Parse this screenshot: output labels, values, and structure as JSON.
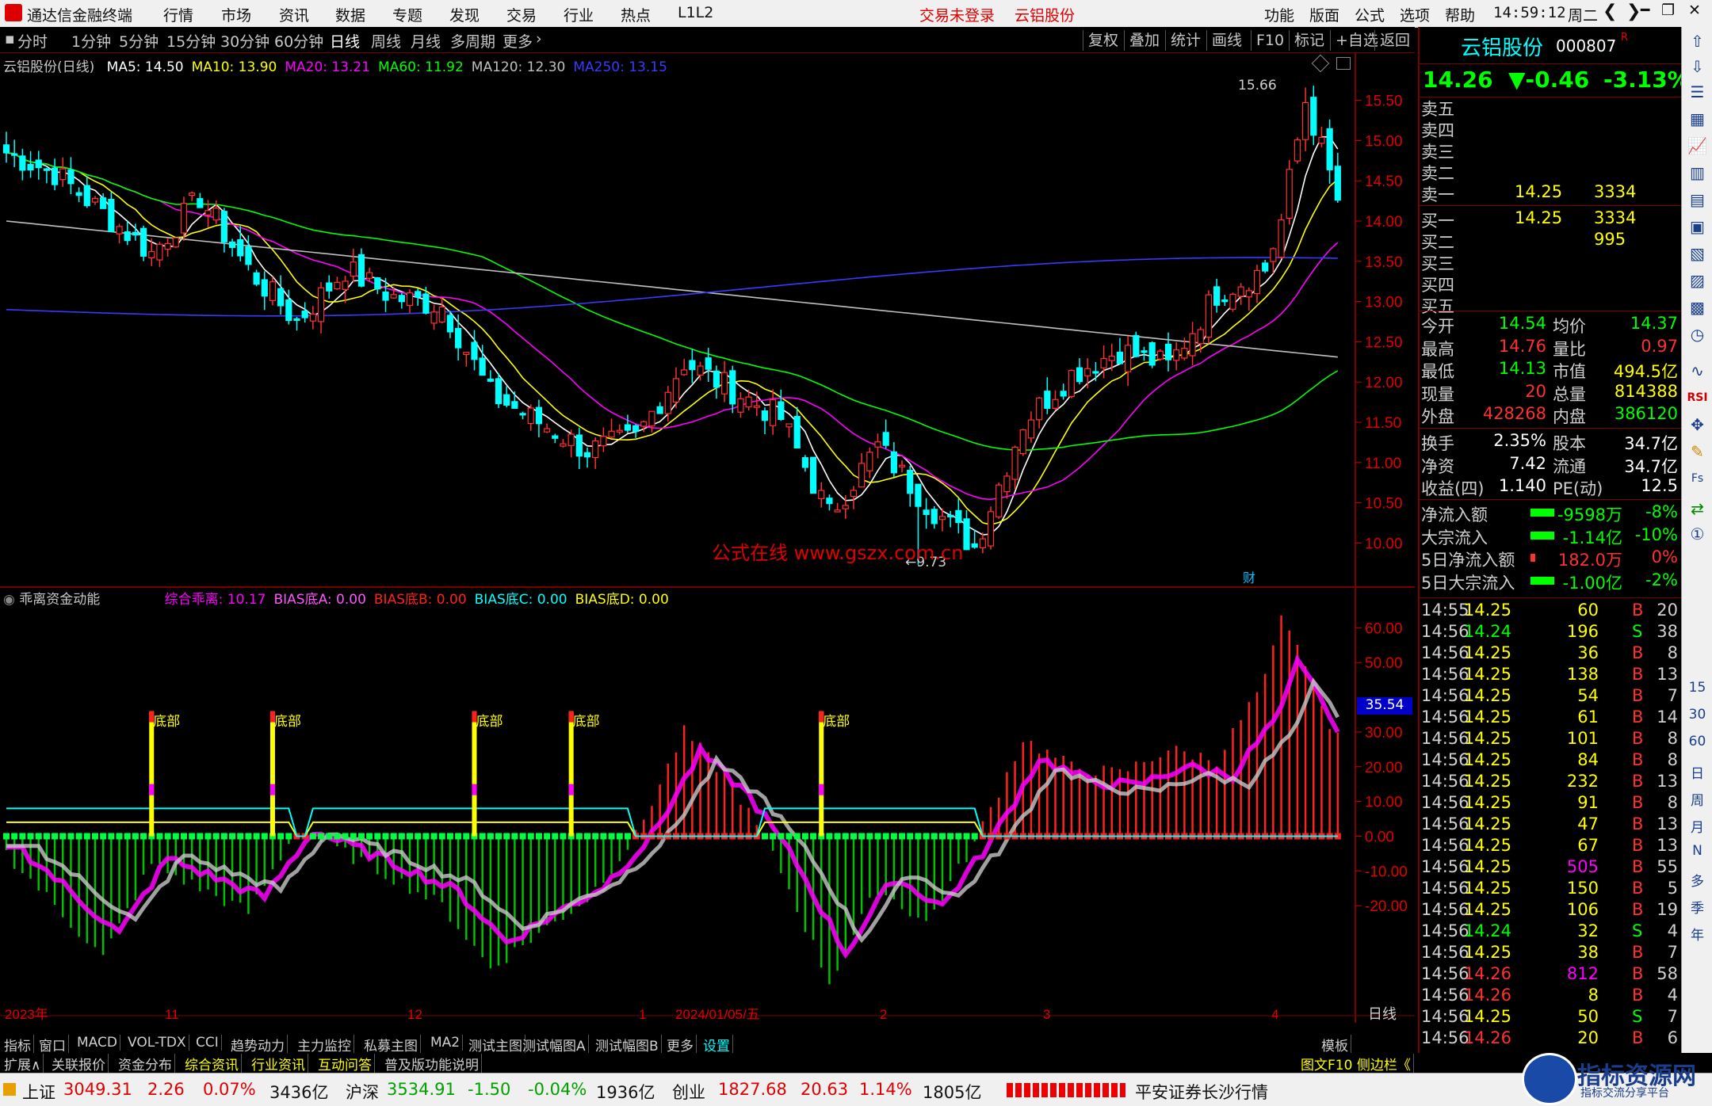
{
  "menubar": {
    "app_title": "通达信金融终端",
    "items": [
      "行情",
      "市场",
      "资讯",
      "数据",
      "专题",
      "发现",
      "交易",
      "行业",
      "热点",
      "L1L2"
    ],
    "login_status": "交易未登录",
    "stock_name": "云铝股份",
    "right_items": [
      "功能",
      "版面",
      "公式",
      "选项",
      "帮助"
    ],
    "time": "14:59:12",
    "weekday": "周二"
  },
  "periodbar": {
    "periods": [
      "分时",
      "1分钟",
      "5分钟",
      "15分钟",
      "30分钟",
      "60分钟",
      "日线",
      "周线",
      "月线",
      "多周期",
      "更多"
    ],
    "active": "日线",
    "tools": [
      "复权",
      "叠加",
      "统计",
      "画线",
      "F10",
      "标记",
      "+自选",
      "返回"
    ]
  },
  "main_legend": {
    "title": "云铝股份(日线)",
    "ma": [
      {
        "label": "MA5: 14.50",
        "color": "#ffffff"
      },
      {
        "label": "MA10: 13.90",
        "color": "#ffff00"
      },
      {
        "label": "MA20: 13.21",
        "color": "#ff00ff"
      },
      {
        "label": "MA60: 11.92",
        "color": "#00ff00"
      },
      {
        "label": "MA120: 12.30",
        "color": "#c0c0c0"
      },
      {
        "label": "MA250: 13.15",
        "color": "#3a3aff"
      }
    ],
    "high_label": "15.66",
    "low_label": "9.73",
    "watermark": "公式在线 www.gszx.com.cn",
    "cai_label": "财"
  },
  "indicator_legend": {
    "title": "乖离资金动能",
    "items": [
      {
        "label": "综合乖离: 10.17",
        "color": "#ff00ff"
      },
      {
        "label": "BIAS底A: 0.00",
        "color": "#ff55ff"
      },
      {
        "label": "BIAS底B: 0.00",
        "color": "#ff2020"
      },
      {
        "label": "BIAS底C: 0.00",
        "color": "#00ffff"
      },
      {
        "label": "BIAS底D: 0.00",
        "color": "#ffff00"
      }
    ],
    "bottom_label": "底部",
    "current_value": "35.54"
  },
  "chart_data": [
    {
      "type": "candlestick",
      "title": "云铝股份(日线)",
      "y_ticks": [
        "15.50",
        "15.00",
        "14.50",
        "14.00",
        "13.50",
        "13.00",
        "12.50",
        "12.00",
        "11.50",
        "11.00",
        "10.50",
        "10.00"
      ],
      "ylim": [
        9.6,
        15.9
      ],
      "high": 15.66,
      "low": 9.73,
      "close_points": [
        [
          0,
          14.85
        ],
        [
          6,
          14.6
        ],
        [
          12,
          14.1
        ],
        [
          18,
          13.6
        ],
        [
          24,
          14.3
        ],
        [
          30,
          13.4
        ],
        [
          36,
          12.75
        ],
        [
          42,
          13.4
        ],
        [
          48,
          13.05
        ],
        [
          54,
          12.95
        ],
        [
          60,
          11.85
        ],
        [
          66,
          11.5
        ],
        [
          72,
          11.15
        ],
        [
          78,
          11.3
        ],
        [
          84,
          12.25
        ],
        [
          90,
          11.9
        ],
        [
          96,
          11.55
        ],
        [
          102,
          10.35
        ],
        [
          108,
          11.2
        ],
        [
          114,
          10.5
        ],
        [
          120,
          9.95
        ],
        [
          126,
          11.5
        ],
        [
          132,
          12.1
        ],
        [
          138,
          12.4
        ],
        [
          144,
          12.2
        ],
        [
          150,
          13.1
        ],
        [
          156,
          13.4
        ],
        [
          158,
          14.0
        ],
        [
          161,
          15.5
        ],
        [
          163,
          14.9
        ],
        [
          165,
          14.26
        ]
      ]
    },
    {
      "type": "bar",
      "title": "乖离资金动能",
      "y_ticks": [
        "60.00",
        "50.00",
        "30.00",
        "20.00",
        "10.00",
        "0.00",
        "-10.00",
        "-20.00"
      ],
      "ylim": [
        -48,
        66
      ],
      "bottom_markers": [
        "底部",
        "底部",
        "底部",
        "底部",
        "底部"
      ],
      "value_points": [
        [
          0,
          -5
        ],
        [
          6,
          -20
        ],
        [
          12,
          -35
        ],
        [
          18,
          -8
        ],
        [
          24,
          -15
        ],
        [
          30,
          -22
        ],
        [
          36,
          2
        ],
        [
          42,
          -5
        ],
        [
          48,
          -12
        ],
        [
          54,
          -20
        ],
        [
          60,
          -38
        ],
        [
          66,
          -28
        ],
        [
          72,
          -18
        ],
        [
          78,
          0
        ],
        [
          84,
          30
        ],
        [
          90,
          15
        ],
        [
          96,
          -10
        ],
        [
          102,
          -42
        ],
        [
          108,
          -15
        ],
        [
          114,
          -25
        ],
        [
          120,
          -2
        ],
        [
          126,
          28
        ],
        [
          132,
          20
        ],
        [
          138,
          18
        ],
        [
          144,
          25
        ],
        [
          150,
          22
        ],
        [
          156,
          45
        ],
        [
          158,
          62
        ],
        [
          161,
          50
        ],
        [
          163,
          35.54
        ],
        [
          165,
          30
        ]
      ]
    }
  ],
  "x_axis_labels": [
    "2023年",
    "11",
    "12",
    "1",
    "2024/01/05/五",
    "2",
    "3",
    "4",
    "日线"
  ],
  "right_panel": {
    "name": "云铝股份",
    "code": "000807",
    "r_mark": "R",
    "price": "14.26",
    "change": "▼-0.46",
    "pct": "-3.13%",
    "asks": [
      {
        "label": "卖五",
        "price": "",
        "vol": ""
      },
      {
        "label": "卖四",
        "price": "",
        "vol": ""
      },
      {
        "label": "卖三",
        "price": "",
        "vol": ""
      },
      {
        "label": "卖二",
        "price": "",
        "vol": ""
      },
      {
        "label": "卖一",
        "price": "14.25",
        "vol": "3334"
      }
    ],
    "bids": [
      {
        "label": "买一",
        "price": "14.25",
        "vol": "3334"
      },
      {
        "label": "买二",
        "price": "",
        "vol": "995"
      },
      {
        "label": "买三",
        "price": "",
        "vol": ""
      },
      {
        "label": "买四",
        "price": "",
        "vol": ""
      },
      {
        "label": "买五",
        "price": "",
        "vol": ""
      }
    ],
    "stats1": [
      [
        "今开",
        "14.54",
        "均价",
        "14.37"
      ],
      [
        "最高",
        "14.76",
        "量比",
        "0.97"
      ],
      [
        "最低",
        "14.13",
        "市值",
        "494.5亿"
      ],
      [
        "现量",
        "20",
        "总量",
        "814388"
      ],
      [
        "外盘",
        "428268",
        "内盘",
        "386120"
      ]
    ],
    "stats2": [
      [
        "换手",
        "2.35%",
        "股本",
        "34.7亿"
      ],
      [
        "净资",
        "7.42",
        "流通",
        "34.7亿"
      ],
      [
        "收益(四)",
        "1.140",
        "PE(动)",
        "12.5"
      ]
    ],
    "flows": [
      [
        "净流入额",
        "-9598万",
        "-8%"
      ],
      [
        "大宗流入",
        "-1.14亿",
        "-10%"
      ],
      [
        "5日净流入额",
        "182.0万",
        "0%"
      ],
      [
        "5日大宗流入",
        "-1.00亿",
        "-2%"
      ]
    ],
    "ticks": [
      [
        "14:55",
        "14.25",
        "60",
        "B",
        "20"
      ],
      [
        "14:56",
        "14.24",
        "196",
        "S",
        "38"
      ],
      [
        "14:56",
        "14.25",
        "36",
        "B",
        "8"
      ],
      [
        "14:56",
        "14.25",
        "138",
        "B",
        "13"
      ],
      [
        "14:56",
        "14.25",
        "54",
        "B",
        "7"
      ],
      [
        "14:56",
        "14.25",
        "61",
        "B",
        "14"
      ],
      [
        "14:56",
        "14.25",
        "101",
        "B",
        "8"
      ],
      [
        "14:56",
        "14.25",
        "84",
        "B",
        "8"
      ],
      [
        "14:56",
        "14.25",
        "232",
        "B",
        "13"
      ],
      [
        "14:56",
        "14.25",
        "91",
        "B",
        "8"
      ],
      [
        "14:56",
        "14.25",
        "47",
        "B",
        "13"
      ],
      [
        "14:56",
        "14.25",
        "67",
        "B",
        "13"
      ],
      [
        "14:56",
        "14.25",
        "505",
        "B",
        "55"
      ],
      [
        "14:56",
        "14.25",
        "150",
        "B",
        "5"
      ],
      [
        "14:56",
        "14.25",
        "106",
        "B",
        "19"
      ],
      [
        "14:56",
        "14.24",
        "32",
        "S",
        "4"
      ],
      [
        "14:56",
        "14.25",
        "38",
        "B",
        "7"
      ],
      [
        "14:56",
        "14.26",
        "812",
        "B",
        "58"
      ],
      [
        "14:56",
        "14.26",
        "8",
        "B",
        "4"
      ],
      [
        "14:56",
        "14.25",
        "50",
        "S",
        "7"
      ],
      [
        "14:56",
        "14.26",
        "20",
        "B",
        "6"
      ]
    ],
    "bottom_tabs": [
      "笔",
      "价",
      "细"
    ]
  },
  "sidebar": {
    "items": [
      "日",
      "周",
      "月",
      "N",
      "多",
      "季",
      "年"
    ],
    "num_items": [
      "15",
      "30",
      "60"
    ],
    "icon_labels": [
      "RSI",
      "Fs"
    ]
  },
  "tabs1": [
    "指标",
    "窗口",
    "MACD",
    "VOL-TDX",
    "CCI",
    "趋势动力",
    "主力监控",
    "私募主图",
    "MA2",
    "测试主图",
    "测试幅图A",
    "测试幅图B",
    "更多",
    "设置",
    "模板"
  ],
  "tabs2": [
    "扩展∧",
    "关联报价",
    "资金分布",
    "综合资讯",
    "行业资讯",
    "互动问答",
    "普及版功能说明"
  ],
  "tabs2_right": "图文F10 侧边栏《",
  "statusbar": {
    "indices": [
      {
        "name": "上证",
        "value": "3049.31",
        "chg": "2.26",
        "pct": "0.07%",
        "amt": "3436亿"
      },
      {
        "name": "沪深",
        "value": "3534.91",
        "chg": "-1.50",
        "pct": "-0.04%",
        "amt": "1936亿"
      },
      {
        "name": "创业",
        "value": "1827.68",
        "chg": "20.63",
        "pct": "1.14%",
        "amt": "1805亿"
      }
    ],
    "broker": "平安证券长沙行情",
    "brand": "指标资源网",
    "brand_sub": "指标交流分享平台"
  }
}
